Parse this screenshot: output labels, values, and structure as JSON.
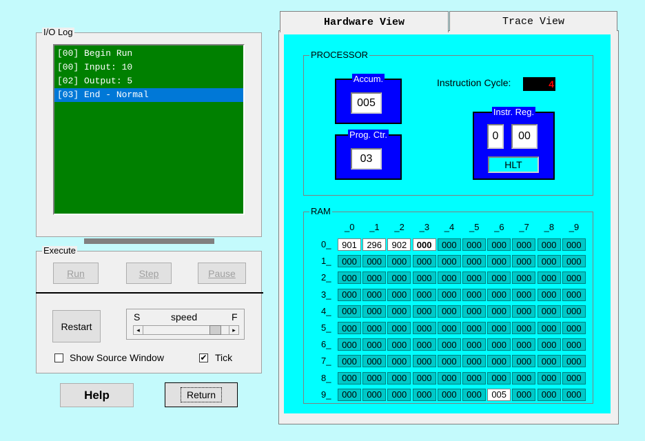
{
  "io_log": {
    "title": "I/O Log",
    "lines": [
      "[00] Begin Run",
      "[00] Input: 10",
      "[02] Output: 5",
      "[03] End - Normal"
    ],
    "selected_index": 3,
    "background_color": "#008000"
  },
  "execute": {
    "title": "Execute",
    "run_label": "Run",
    "step_label": "Step",
    "pause_label": "Pause",
    "restart_label": "Restart",
    "speed_label": "speed",
    "speed_slow": "S",
    "speed_fast": "F",
    "show_source_label": "Show Source Window",
    "show_source_checked": false,
    "tick_label": "Tick",
    "tick_checked": true,
    "speed_value": 0.9
  },
  "buttons": {
    "help_label": "Help",
    "return_label": "Return"
  },
  "tabs": {
    "hardware": "Hardware View",
    "trace": "Trace View"
  },
  "processor": {
    "title": "PROCESSOR",
    "accum_label": "Accum.",
    "accum_value": "005",
    "progctr_label": "Prog. Ctr.",
    "progctr_value": "03",
    "instr_cycle_label": "Instruction Cycle:",
    "instr_cycle_value": "4",
    "instr_reg_label": "Instr. Reg.",
    "instr_reg_op": "0",
    "instr_reg_addr": "00",
    "instr_mnemonic": "HLT"
  },
  "ram": {
    "title": "RAM",
    "col_headers": [
      "_0",
      "_1",
      "_2",
      "_3",
      "_4",
      "_5",
      "_6",
      "_7",
      "_8",
      "_9"
    ],
    "row_headers": [
      "0_",
      "1_",
      "2_",
      "3_",
      "4_",
      "5_",
      "6_",
      "7_",
      "8_",
      "9_"
    ],
    "rows": [
      [
        "901",
        "296",
        "902",
        "000",
        "000",
        "000",
        "000",
        "000",
        "000",
        "000"
      ],
      [
        "000",
        "000",
        "000",
        "000",
        "000",
        "000",
        "000",
        "000",
        "000",
        "000"
      ],
      [
        "000",
        "000",
        "000",
        "000",
        "000",
        "000",
        "000",
        "000",
        "000",
        "000"
      ],
      [
        "000",
        "000",
        "000",
        "000",
        "000",
        "000",
        "000",
        "000",
        "000",
        "000"
      ],
      [
        "000",
        "000",
        "000",
        "000",
        "000",
        "000",
        "000",
        "000",
        "000",
        "000"
      ],
      [
        "000",
        "000",
        "000",
        "000",
        "000",
        "000",
        "000",
        "000",
        "000",
        "000"
      ],
      [
        "000",
        "000",
        "000",
        "000",
        "000",
        "000",
        "000",
        "000",
        "000",
        "000"
      ],
      [
        "000",
        "000",
        "000",
        "000",
        "000",
        "000",
        "000",
        "000",
        "000",
        "000"
      ],
      [
        "000",
        "000",
        "000",
        "000",
        "000",
        "000",
        "000",
        "000",
        "000",
        "000"
      ],
      [
        "000",
        "000",
        "000",
        "000",
        "000",
        "000",
        "005",
        "000",
        "000",
        "000"
      ]
    ],
    "white_cells": [
      [
        0,
        0
      ],
      [
        0,
        1
      ],
      [
        0,
        2
      ],
      [
        0,
        3
      ],
      [
        9,
        6
      ]
    ],
    "bold_cells": [
      [
        0,
        3
      ]
    ]
  }
}
